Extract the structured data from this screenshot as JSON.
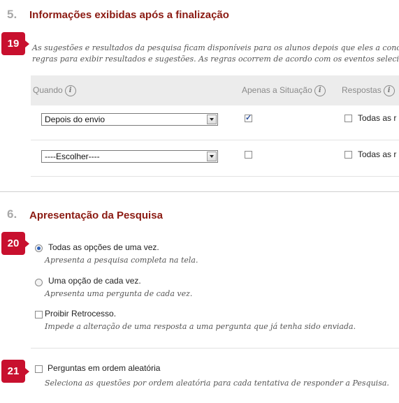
{
  "section5": {
    "number": "5.",
    "title": "Informações exibidas após a finalização",
    "badge": "19",
    "description_line1": "As sugestões e resultados da pesquisa ficam disponíveis para os alunos depois que eles a conclu",
    "description_line2": "regras para exibir resultados e sugestões. As regras ocorrem de acordo com os eventos selecio",
    "table": {
      "headers": {
        "when": "Quando",
        "status_only": "Apenas a Situação",
        "answers": "Respostas"
      },
      "rows": [
        {
          "select_value": "Depois do envio",
          "status_only_checked": true,
          "answers_checked": false,
          "answers_label": "Todas as r"
        },
        {
          "select_value": "----Escolher----",
          "status_only_checked": false,
          "answers_checked": false,
          "answers_label": "Todas as r"
        }
      ]
    }
  },
  "section6": {
    "number": "6.",
    "title": "Apresentação da Pesquisa",
    "badge_presentation": "20",
    "badge_random": "21",
    "options": {
      "all_at_once": {
        "label": "Todas as opções de uma vez.",
        "description": "Apresenta a pesquisa completa na tela.",
        "selected": true
      },
      "one_at_a_time": {
        "label": "Uma opção de cada vez.",
        "description": "Apresenta uma pergunta de cada vez.",
        "selected": false
      }
    },
    "prohibit_backtracking": {
      "label": "Proibir Retrocesso.",
      "description": "Impede a alteração de uma resposta a uma pergunta que já tenha sido enviada.",
      "checked": false
    },
    "random_order": {
      "label": "Perguntas em ordem aleatória",
      "description": "Seleciona as questões por ordem aleatória para cada tentativa de responder a Pesquisa.",
      "checked": false
    }
  },
  "icons": {
    "info": "info-icon",
    "dropdown": "chevron-down-icon"
  },
  "colors": {
    "title": "#8b1a12",
    "badge": "#c8102e",
    "step_number": "#a8a8a8",
    "table_header": "#ececec"
  }
}
